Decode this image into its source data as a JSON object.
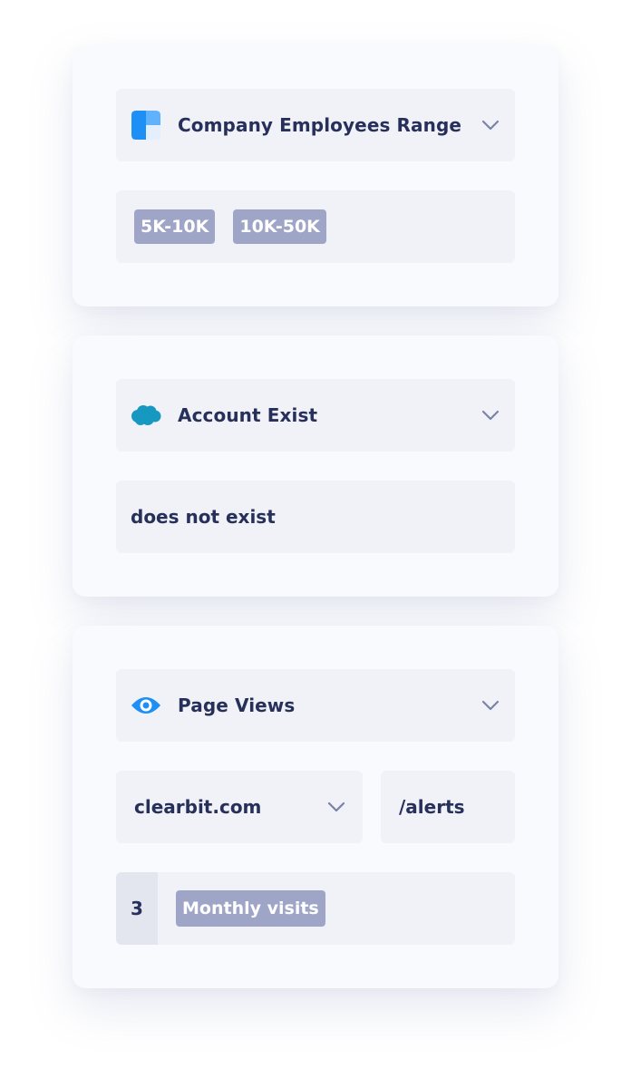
{
  "cards": [
    {
      "attribute": {
        "label": "Company Employees Range",
        "icon": "clearbit-logo-icon"
      },
      "tags": [
        "5K-10K",
        "10K-50K"
      ]
    },
    {
      "attribute": {
        "label": "Account Exist",
        "icon": "salesforce-cloud-icon"
      },
      "value": "does not exist"
    },
    {
      "attribute": {
        "label": "Page Views",
        "icon": "eye-icon"
      },
      "domain": "clearbit.com",
      "path": "/alerts",
      "count": "3",
      "count_tag": "Monthly visits"
    }
  ],
  "colors": {
    "accent_blue": "#1e8ff5",
    "salesforce_blue": "#1798c1",
    "tag_bg": "#9ea5c7",
    "text": "#26305a"
  }
}
